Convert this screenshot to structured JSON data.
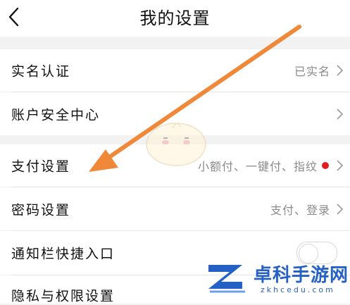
{
  "header": {
    "back_icon": "chevron-left-icon",
    "title": "我的设置"
  },
  "rows": {
    "real_name": {
      "label": "实名认证",
      "value": "已实名"
    },
    "account_security": {
      "label": "账户安全中心"
    },
    "payment_settings": {
      "label": "支付设置",
      "value": "小额付、一键付、指纹"
    },
    "password_settings": {
      "label": "密码设置",
      "value": "支付、登录"
    },
    "notification_shortcut": {
      "label": "通知栏快捷入口"
    },
    "privacy": {
      "label": "隐私与权限设置"
    }
  },
  "colors": {
    "accent_arrow": "#f0883a",
    "status_dot": "#e02020",
    "watermark_blue": "#2561c4"
  },
  "watermark": {
    "name": "卓科手游网",
    "domain": "zkhcedu.com"
  }
}
